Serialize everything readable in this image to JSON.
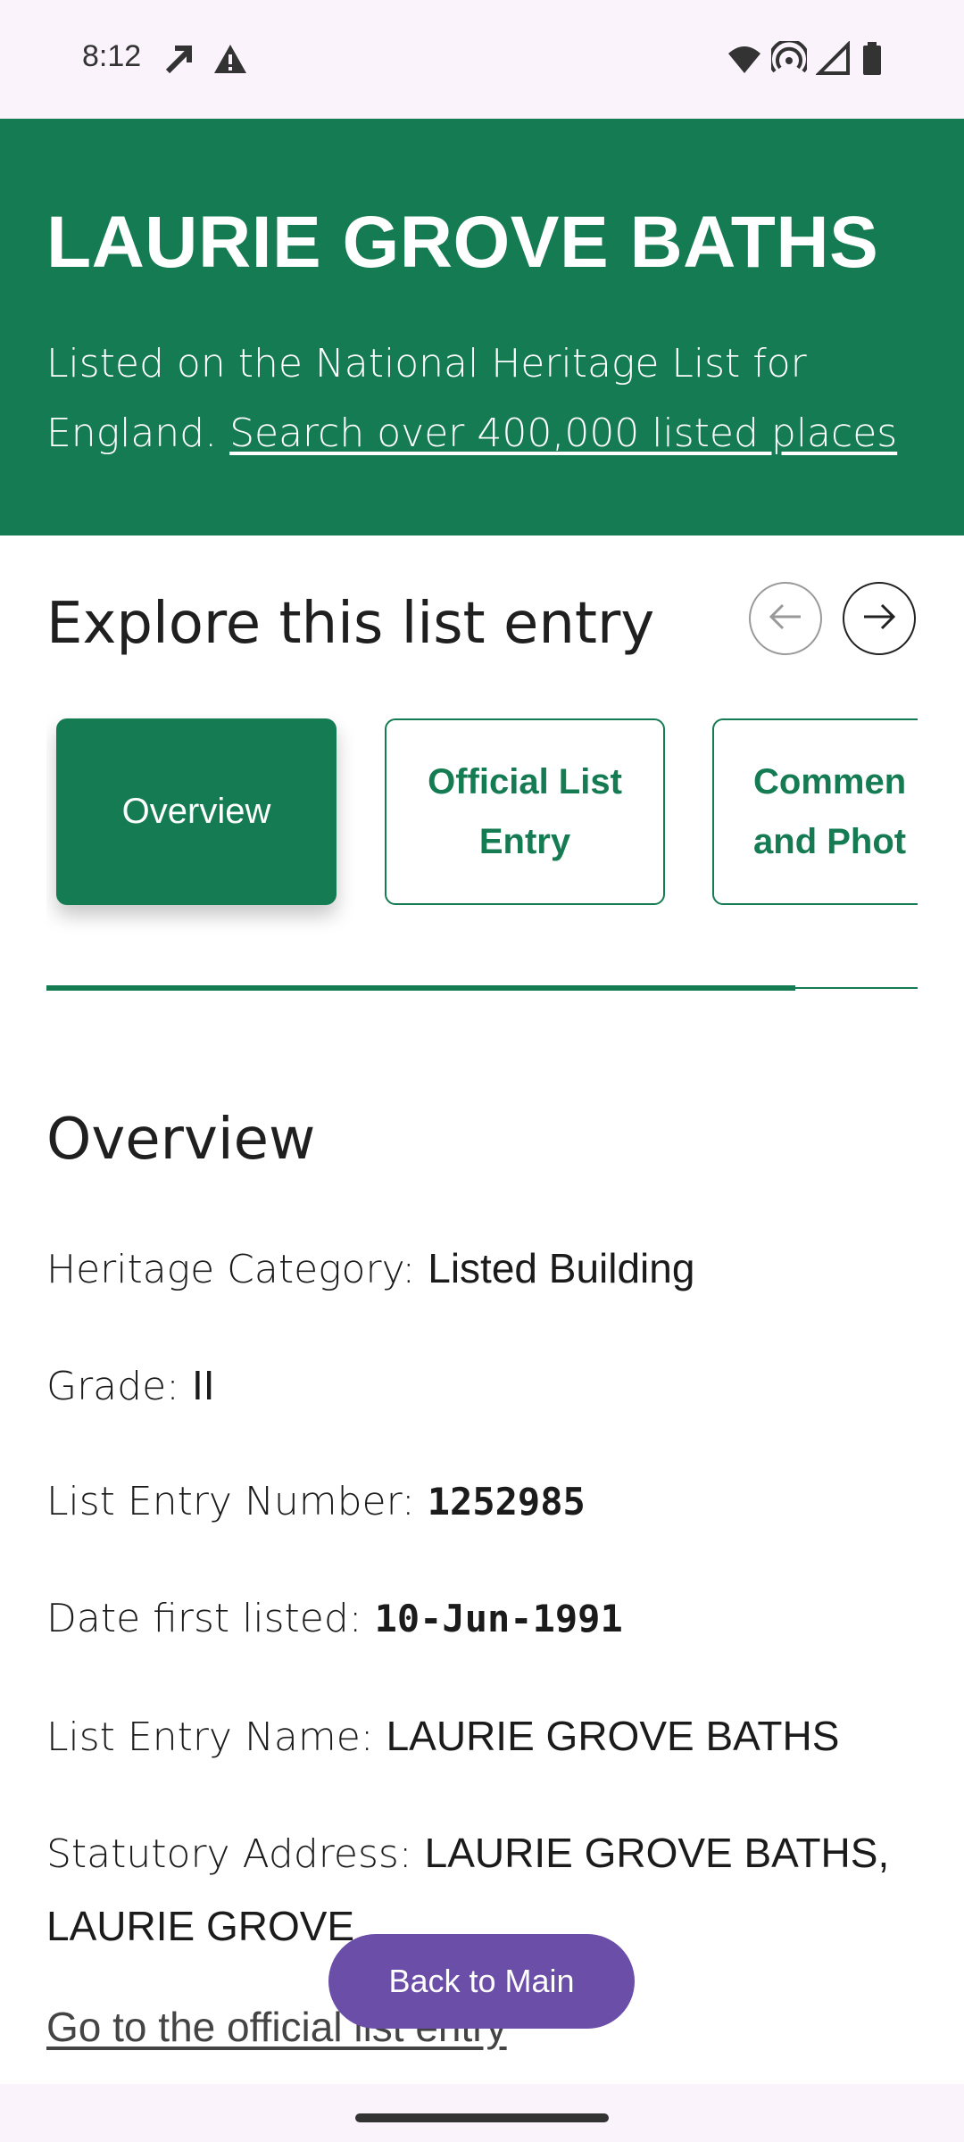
{
  "status_bar": {
    "time": "8:12",
    "left_icons": [
      "navigation-arrow-icon",
      "warning-icon"
    ],
    "right_icons": [
      "wifi-icon",
      "hotspot-icon",
      "signal-icon",
      "battery-icon"
    ]
  },
  "hero": {
    "title": "LAURIE GROVE BATHS",
    "subtitle": "Listed on the National Heritage List for England.",
    "link": "Search over 400,000 listed places",
    "background": "#157b53"
  },
  "explore": {
    "title": "Explore this list entry",
    "prev_icon": "arrow-left-icon",
    "next_icon": "arrow-right-icon",
    "tabs": [
      {
        "label": "Overview",
        "active": true
      },
      {
        "label": "Official List Entry",
        "active": false
      },
      {
        "label": "Comments and Photos",
        "active": false
      }
    ],
    "tab3_visible_lines": [
      "Commen",
      "and Phot"
    ],
    "scroll_progress_percent": 86
  },
  "overview": {
    "title": "Overview",
    "fields": [
      {
        "label": "Heritage Category:",
        "value": "Listed Building"
      },
      {
        "label": "Grade:",
        "value": "II"
      },
      {
        "label": "List Entry Number:",
        "value": "1252985"
      },
      {
        "label": "Date first listed:",
        "value": "10-Jun-1991"
      },
      {
        "label": "List Entry Name:",
        "value": "LAURIE GROVE BATHS"
      },
      {
        "label": "Statutory Address:",
        "value": "LAURIE GROVE BATHS, LAURIE GROVE"
      }
    ],
    "official_link": "Go to the official list entry"
  },
  "fab": {
    "label": "Back to Main",
    "color": "#6a4ea8"
  }
}
